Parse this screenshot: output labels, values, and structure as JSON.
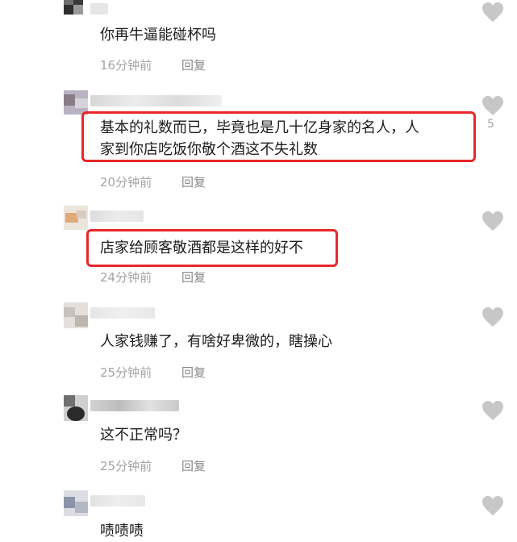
{
  "colors": {
    "highlight": "#e8272a",
    "meta": "#a3a3a3",
    "heart": "#c7c7c7"
  },
  "like_icon": "heart-icon",
  "comments": [
    {
      "text": "你再牛逼能碰杯吗",
      "time": "16分钟前",
      "reply": "回复"
    },
    {
      "text_line1": "基本的礼数而已，毕竟也是几十亿身家的名人，人",
      "text_line2": "家到你店吃饭你敬个酒这不失礼数",
      "time": "20分钟前",
      "reply": "回复",
      "likes": "5"
    },
    {
      "text": "店家给顾客敬酒都是这样的好不",
      "time": "24分钟前",
      "reply": "回复"
    },
    {
      "text": "人家钱赚了，有啥好卑微的，瞎操心",
      "time": "25分钟前",
      "reply": "回复"
    },
    {
      "text": "这不正常吗？",
      "time": "25分钟前",
      "reply": "回复"
    },
    {
      "text": "啧啧啧",
      "time": "",
      "reply": ""
    }
  ]
}
